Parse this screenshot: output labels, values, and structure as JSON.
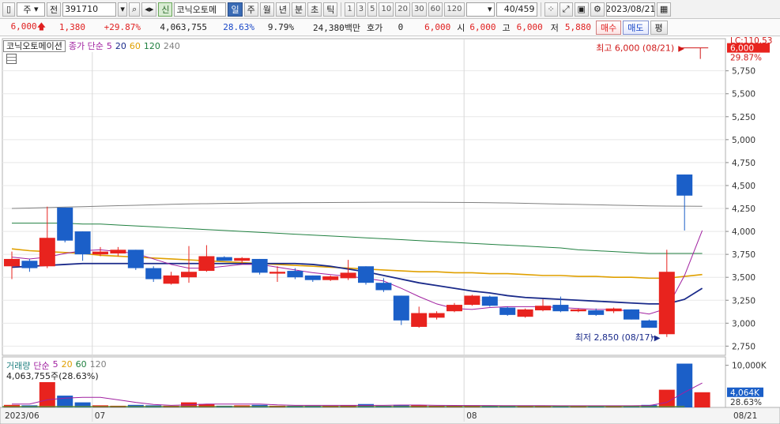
{
  "toolbar": {
    "period_label": "주",
    "prev_label": "전",
    "code": "391710",
    "new_tag": "신",
    "stock_name": "코닉오토메",
    "tabs": [
      "일",
      "주",
      "월",
      "년",
      "분",
      "초",
      "틱"
    ],
    "minutes": [
      "1",
      "3",
      "5",
      "10",
      "20",
      "30",
      "60",
      "120"
    ],
    "count_display": "40/459",
    "date": "2023/08/21"
  },
  "quote": {
    "price": "6,000",
    "change": "1,380",
    "change_pct": "+29.87%",
    "volume": "4,063,755",
    "vol_ratio": "28.63%",
    "turnover": "9.79%",
    "amount": "24,380백만",
    "hoga_label": "호가",
    "hoga_value": "0",
    "current": "6,000",
    "open_label": "시",
    "open": "6,000",
    "high_label": "고",
    "high": "6,000",
    "low_label": "저",
    "low": "5,880",
    "buy_label": "매수",
    "sell_label": "매도",
    "avg_label": "평"
  },
  "legend": {
    "name": "코닉오토메이션",
    "ma_label": "종가 단순",
    "ma_periods": [
      "5",
      "20",
      "60",
      "120",
      "240"
    ],
    "ma_colors": [
      "#a020a0",
      "#1a2a8a",
      "#e0a000",
      "#208040",
      "#808080"
    ]
  },
  "annotations": {
    "high_text": "최고 6,000 (08/21)",
    "low_text": "최저 2,850 (08/17)",
    "lc_text": "LC:110.53",
    "price_tag": "6,000",
    "pct_tag": "29.87%"
  },
  "volume_legend": {
    "name": "거래량",
    "ma_label": "단순",
    "periods": [
      "5",
      "20",
      "60",
      "120"
    ],
    "colors": [
      "#a020a0",
      "#e0a000",
      "#208040",
      "#808080"
    ],
    "info": "4,063,755주(28.63%)",
    "axis_10k": "10,000K",
    "vol_tag": "4,064K",
    "vol_pct": "28.63%"
  },
  "x_labels": [
    "2023/06",
    "07",
    "08",
    "08/21"
  ],
  "chart_data": {
    "type": "candlestick",
    "y_ticks": [
      2750,
      3000,
      3250,
      3500,
      3750,
      4000,
      4250,
      4500,
      4750,
      5000,
      5250,
      5500,
      5750
    ],
    "ylim": [
      2650,
      6100
    ],
    "candles": [
      {
        "o": 3620,
        "h": 3780,
        "l": 3480,
        "c": 3700
      },
      {
        "o": 3680,
        "h": 3700,
        "l": 3560,
        "c": 3600
      },
      {
        "o": 3620,
        "h": 4270,
        "l": 3600,
        "c": 3930
      },
      {
        "o": 4260,
        "h": 4260,
        "l": 3880,
        "c": 3900
      },
      {
        "o": 4000,
        "h": 4000,
        "l": 3680,
        "c": 3750
      },
      {
        "o": 3750,
        "h": 3830,
        "l": 3730,
        "c": 3780
      },
      {
        "o": 3760,
        "h": 3830,
        "l": 3730,
        "c": 3800
      },
      {
        "o": 3800,
        "h": 3800,
        "l": 3580,
        "c": 3600
      },
      {
        "o": 3600,
        "h": 3620,
        "l": 3450,
        "c": 3480
      },
      {
        "o": 3430,
        "h": 3560,
        "l": 3420,
        "c": 3520
      },
      {
        "o": 3500,
        "h": 3840,
        "l": 3440,
        "c": 3560
      },
      {
        "o": 3570,
        "h": 3850,
        "l": 3560,
        "c": 3730
      },
      {
        "o": 3720,
        "h": 3730,
        "l": 3690,
        "c": 3680
      },
      {
        "o": 3680,
        "h": 3720,
        "l": 3650,
        "c": 3710
      },
      {
        "o": 3700,
        "h": 3700,
        "l": 3530,
        "c": 3550
      },
      {
        "o": 3540,
        "h": 3620,
        "l": 3450,
        "c": 3560
      },
      {
        "o": 3570,
        "h": 3600,
        "l": 3480,
        "c": 3500
      },
      {
        "o": 3520,
        "h": 3520,
        "l": 3450,
        "c": 3470
      },
      {
        "o": 3470,
        "h": 3520,
        "l": 3460,
        "c": 3510
      },
      {
        "o": 3490,
        "h": 3690,
        "l": 3470,
        "c": 3550
      },
      {
        "o": 3620,
        "h": 3620,
        "l": 3420,
        "c": 3440
      },
      {
        "o": 3440,
        "h": 3490,
        "l": 3340,
        "c": 3360
      },
      {
        "o": 3300,
        "h": 3300,
        "l": 2980,
        "c": 3030
      },
      {
        "o": 2960,
        "h": 3180,
        "l": 2950,
        "c": 3110
      },
      {
        "o": 3060,
        "h": 3130,
        "l": 3040,
        "c": 3110
      },
      {
        "o": 3130,
        "h": 3220,
        "l": 3120,
        "c": 3200
      },
      {
        "o": 3200,
        "h": 3310,
        "l": 3190,
        "c": 3300
      },
      {
        "o": 3290,
        "h": 3300,
        "l": 3180,
        "c": 3190
      },
      {
        "o": 3170,
        "h": 3180,
        "l": 3080,
        "c": 3090
      },
      {
        "o": 3070,
        "h": 3160,
        "l": 3060,
        "c": 3150
      },
      {
        "o": 3140,
        "h": 3260,
        "l": 3130,
        "c": 3190
      },
      {
        "o": 3200,
        "h": 3290,
        "l": 3120,
        "c": 3130
      },
      {
        "o": 3130,
        "h": 3160,
        "l": 3120,
        "c": 3150
      },
      {
        "o": 3140,
        "h": 3160,
        "l": 3080,
        "c": 3090
      },
      {
        "o": 3130,
        "h": 3170,
        "l": 3110,
        "c": 3160
      },
      {
        "o": 3150,
        "h": 3150,
        "l": 3040,
        "c": 3040
      },
      {
        "o": 3030,
        "h": 3040,
        "l": 2950,
        "c": 2950
      },
      {
        "o": 2880,
        "h": 3800,
        "l": 2850,
        "c": 3560
      },
      {
        "o": 4620,
        "h": 4620,
        "l": 4010,
        "c": 4390
      }
    ],
    "ma5": [
      3720,
      3700,
      3720,
      3760,
      3790,
      3800,
      3780,
      3760,
      3700,
      3640,
      3600,
      3600,
      3620,
      3640,
      3640,
      3610,
      3580,
      3550,
      3530,
      3510,
      3490,
      3460,
      3380,
      3290,
      3210,
      3160,
      3150,
      3170,
      3180,
      3180,
      3180,
      3170,
      3160,
      3150,
      3150,
      3130,
      3100,
      3160,
      3520,
      4010
    ],
    "ma20": [
      3610,
      3620,
      3630,
      3640,
      3650,
      3650,
      3650,
      3650,
      3650,
      3650,
      3650,
      3650,
      3650,
      3650,
      3650,
      3650,
      3650,
      3640,
      3620,
      3590,
      3560,
      3520,
      3480,
      3440,
      3410,
      3380,
      3350,
      3330,
      3300,
      3280,
      3270,
      3260,
      3250,
      3240,
      3230,
      3220,
      3210,
      3210,
      3260,
      3380
    ],
    "ma60": [
      3810,
      3790,
      3780,
      3770,
      3760,
      3740,
      3730,
      3720,
      3710,
      3700,
      3690,
      3680,
      3670,
      3660,
      3650,
      3640,
      3630,
      3620,
      3610,
      3600,
      3590,
      3580,
      3570,
      3560,
      3560,
      3550,
      3550,
      3540,
      3540,
      3530,
      3520,
      3520,
      3510,
      3510,
      3500,
      3500,
      3490,
      3490,
      3510,
      3530
    ],
    "ma120": [
      4090,
      4090,
      4090,
      4090,
      4080,
      4080,
      4070,
      4060,
      4050,
      4040,
      4030,
      4020,
      4010,
      4000,
      3990,
      3980,
      3970,
      3960,
      3950,
      3940,
      3930,
      3920,
      3910,
      3900,
      3890,
      3880,
      3870,
      3860,
      3850,
      3840,
      3830,
      3820,
      3800,
      3790,
      3780,
      3770,
      3760,
      3760,
      3760,
      3760
    ],
    "ma240": [
      4250,
      4255,
      4260,
      4265,
      4270,
      4275,
      4280,
      4285,
      4290,
      4295,
      4300,
      4302,
      4305,
      4307,
      4310,
      4312,
      4313,
      4314,
      4315,
      4316,
      4317,
      4318,
      4318,
      4318,
      4317,
      4316,
      4315,
      4313,
      4310,
      4306,
      4302,
      4298,
      4294,
      4290,
      4286,
      4282,
      4278,
      4276,
      4275,
      4274
    ],
    "volume": [
      30,
      25,
      300,
      140,
      60,
      25,
      20,
      30,
      25,
      20,
      60,
      40,
      20,
      25,
      30,
      20,
      20,
      20,
      20,
      25,
      40,
      20,
      30,
      25,
      20,
      20,
      25,
      20,
      20,
      20,
      20,
      20,
      20,
      20,
      20,
      20,
      30,
      210,
      520,
      180
    ],
    "vol_ma5": [
      40,
      40,
      90,
      110,
      120,
      120,
      90,
      60,
      35,
      25,
      30,
      40,
      40,
      40,
      40,
      30,
      25,
      25,
      25,
      25,
      25,
      25,
      28,
      28,
      25,
      23,
      22,
      22,
      21,
      21,
      21,
      20,
      20,
      20,
      20,
      20,
      22,
      60,
      180,
      290
    ],
    "vol_ylim": [
      0,
      600
    ]
  }
}
